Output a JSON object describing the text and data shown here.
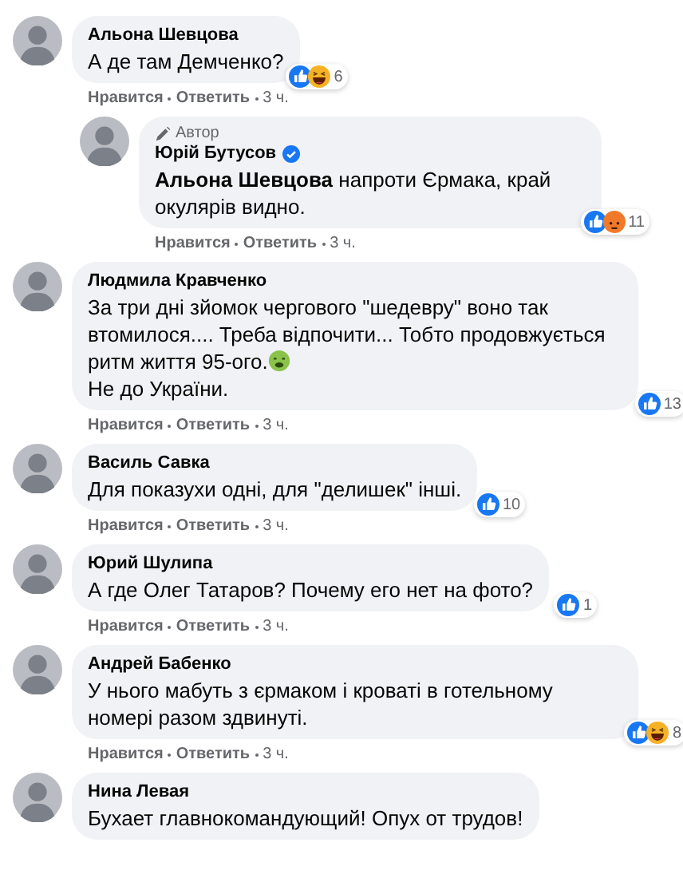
{
  "comments": [
    {
      "author": "Альона Шевцова",
      "body": [
        "А де там Демченко?"
      ],
      "reactions": [
        {
          "kind": "like"
        },
        {
          "kind": "haha"
        }
      ],
      "reaction_count": "6",
      "actions": [
        "Нравится",
        "Ответить",
        "3 ч."
      ],
      "children": [
        {
          "author": "Юрій Бутусов",
          "author_badge": "Автор",
          "verified": true,
          "body": [
            "**Альона Шевцова** напроти Єрмака, край окулярів видно."
          ],
          "reactions": [
            {
              "kind": "like"
            },
            {
              "kind": "angry"
            }
          ],
          "reaction_count": "11",
          "actions": [
            "Нравится",
            "Ответить",
            "3 ч."
          ]
        }
      ]
    },
    {
      "author": "Людмила Кравченко",
      "body": [
        "За три дні зйомок чергового \"шедевру\" воно так втомилося.... Треба відпочити... Тобто продовжується ритм життя 95-ого.",
        "Не до України."
      ],
      "emoji": {
        "kind": "sick"
      },
      "reactions": [
        {
          "kind": "like"
        }
      ],
      "reaction_count": "13",
      "actions": [
        "Нравится",
        "Ответить",
        "3 ч."
      ]
    },
    {
      "author": "Василь Савка",
      "body": [
        "Для показухи одні, для \"делишек\" інші."
      ],
      "reactions": [
        {
          "kind": "like"
        }
      ],
      "reaction_count": "10",
      "actions": [
        "Нравится",
        "Ответить",
        "3 ч."
      ]
    },
    {
      "author": "Юрий Шулипа",
      "body": [
        "А где Олег Татаров? Почему его нет на фото?"
      ],
      "reactions": [
        {
          "kind": "like"
        }
      ],
      "reaction_count": "1",
      "actions": [
        "Нравится",
        "Ответить",
        "3 ч."
      ]
    },
    {
      "author": "Андрей Бабенко",
      "body": [
        "У нього мабуть з єрмаком і кроваті в готельному номері разом здвинуті."
      ],
      "reactions": [
        {
          "kind": "like"
        },
        {
          "kind": "haha"
        }
      ],
      "reaction_count": "8",
      "actions": [
        "Нравится",
        "Ответить",
        "3 ч."
      ]
    },
    {
      "author": "Нина Левая",
      "body": [
        "Бухает главнокомандующий! Опух от трудов!"
      ]
    }
  ]
}
